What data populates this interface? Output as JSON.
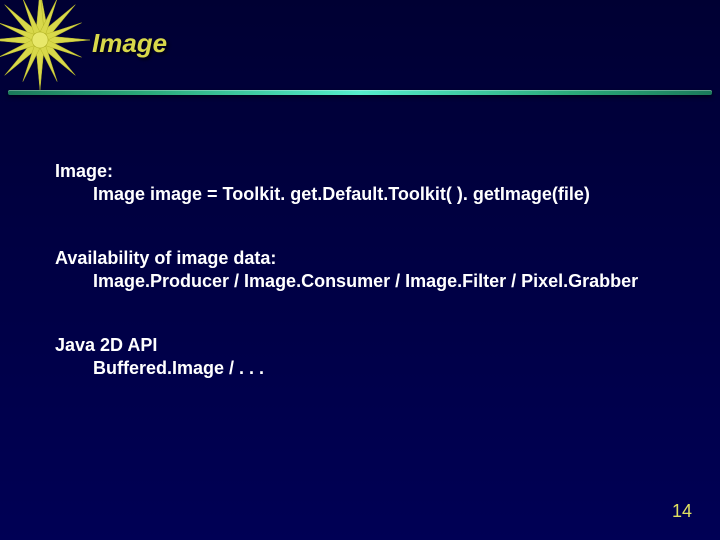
{
  "slide": {
    "title": "Image",
    "sections": [
      {
        "heading": "Image:",
        "body": "Image image = Toolkit. get.Default.Toolkit( ). getImage(file)"
      },
      {
        "heading": "Availability of image data:",
        "body": "Image.Producer / Image.Consumer / Image.Filter / Pixel.Grabber"
      },
      {
        "heading": "Java 2D API",
        "body": "Buffered.Image / . . ."
      }
    ],
    "page_number": "14"
  }
}
